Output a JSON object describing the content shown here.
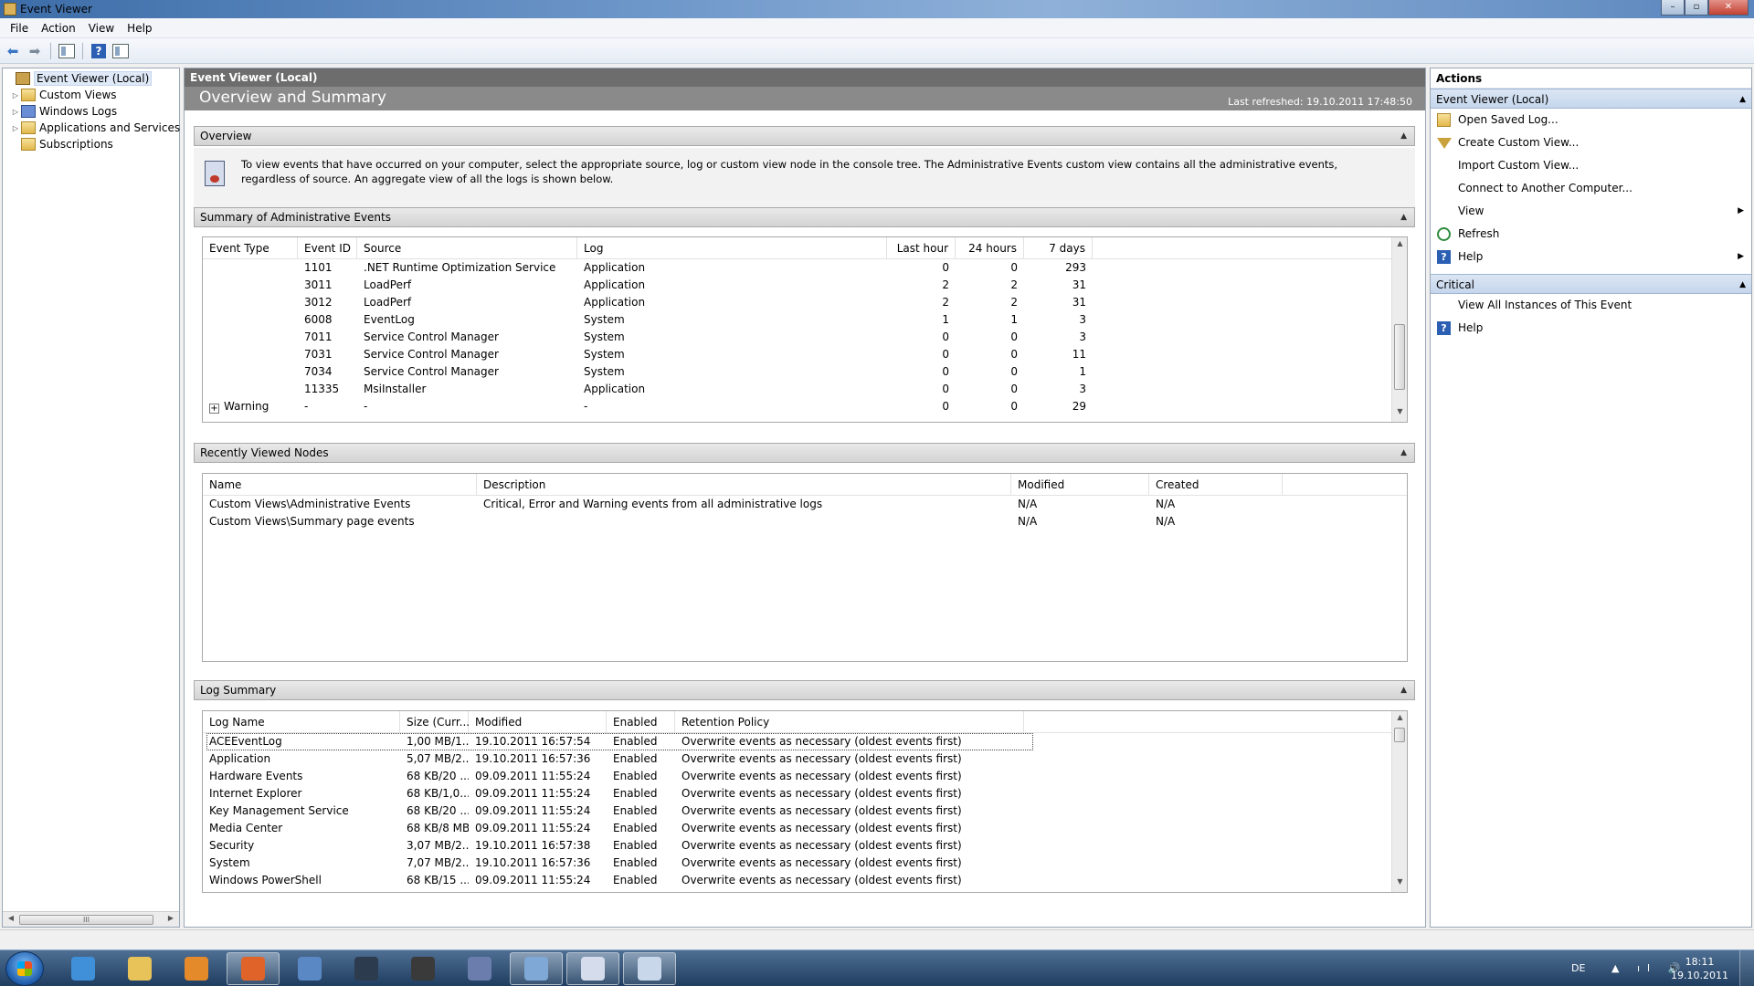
{
  "window": {
    "title": "Event Viewer",
    "buttons": [
      "–",
      "▫",
      "✕"
    ]
  },
  "menubar": [
    "File",
    "Action",
    "View",
    "Help"
  ],
  "toolbar": [
    {
      "name": "back-arrow-icon",
      "glyph": "⬅"
    },
    {
      "name": "forward-arrow-icon",
      "glyph": "➡"
    },
    {
      "name": "show-hide-console-tree-icon",
      "glyph": ""
    },
    {
      "name": "help-icon",
      "glyph": "?"
    },
    {
      "name": "show-hide-action-pane-icon",
      "glyph": ""
    }
  ],
  "tree": {
    "items": [
      {
        "label": "Event Viewer (Local)",
        "icon": "event-viewer-icon",
        "expander": "",
        "selected": true
      },
      {
        "label": "Custom Views",
        "icon": "folder-icon",
        "expander": "▷"
      },
      {
        "label": "Windows Logs",
        "icon": "windows-logs-icon",
        "expander": "▷"
      },
      {
        "label": "Applications and Services Lo",
        "icon": "folder-icon",
        "expander": "▷"
      },
      {
        "label": "Subscriptions",
        "icon": "subscriptions-icon",
        "expander": ""
      }
    ],
    "scroll_thumb": "III"
  },
  "center": {
    "header": "Event Viewer (Local)",
    "banner_title": "Overview and Summary",
    "last_refreshed": "Last refreshed: 19.10.2011 17:48:50",
    "overview": {
      "title": "Overview",
      "text": "To view events that have occurred on your computer, select the appropriate source, log or custom view node in the console tree. The Administrative Events custom view contains all the administrative events, regardless of source. An aggregate view of all the logs is shown below."
    },
    "summary": {
      "title": "Summary of Administrative Events",
      "columns": [
        "Event Type",
        "Event ID",
        "Source",
        "Log",
        "Last hour",
        "24 hours",
        "7 days"
      ],
      "rows": [
        {
          "type": "",
          "id": "1101",
          "source": ".NET Runtime Optimization Service",
          "log": "Application",
          "hour": "0",
          "day": "0",
          "week": "293"
        },
        {
          "type": "",
          "id": "3011",
          "source": "LoadPerf",
          "log": "Application",
          "hour": "2",
          "day": "2",
          "week": "31"
        },
        {
          "type": "",
          "id": "3012",
          "source": "LoadPerf",
          "log": "Application",
          "hour": "2",
          "day": "2",
          "week": "31"
        },
        {
          "type": "",
          "id": "6008",
          "source": "EventLog",
          "log": "System",
          "hour": "1",
          "day": "1",
          "week": "3"
        },
        {
          "type": "",
          "id": "7011",
          "source": "Service Control Manager",
          "log": "System",
          "hour": "0",
          "day": "0",
          "week": "3"
        },
        {
          "type": "",
          "id": "7031",
          "source": "Service Control Manager",
          "log": "System",
          "hour": "0",
          "day": "0",
          "week": "11"
        },
        {
          "type": "",
          "id": "7034",
          "source": "Service Control Manager",
          "log": "System",
          "hour": "0",
          "day": "0",
          "week": "1"
        },
        {
          "type": "",
          "id": "11335",
          "source": "MsiInstaller",
          "log": "Application",
          "hour": "0",
          "day": "0",
          "week": "3"
        },
        {
          "type": "Warning",
          "id": "-",
          "source": "-",
          "log": "-",
          "hour": "0",
          "day": "0",
          "week": "29",
          "expandable": true
        }
      ]
    },
    "recent": {
      "title": "Recently Viewed Nodes",
      "columns": [
        "Name",
        "Description",
        "Modified",
        "Created"
      ],
      "rows": [
        {
          "name": "Custom Views\\Administrative Events",
          "description": "Critical, Error and Warning events from all administrative logs",
          "modified": "N/A",
          "created": "N/A"
        },
        {
          "name": "Custom Views\\Summary page events",
          "description": "",
          "modified": "N/A",
          "created": "N/A"
        }
      ]
    },
    "logs": {
      "title": "Log Summary",
      "columns": [
        "Log Name",
        "Size (Curr...",
        "Modified",
        "Enabled",
        "Retention Policy"
      ],
      "rows": [
        {
          "name": "ACEEventLog",
          "size": "1,00 MB/1...",
          "modified": "19.10.2011 16:57:54",
          "enabled": "Enabled",
          "policy": "Overwrite events as necessary (oldest events first)"
        },
        {
          "name": "Application",
          "size": "5,07 MB/2...",
          "modified": "19.10.2011 16:57:36",
          "enabled": "Enabled",
          "policy": "Overwrite events as necessary (oldest events first)"
        },
        {
          "name": "Hardware Events",
          "size": "68 KB/20 ...",
          "modified": "09.09.2011 11:55:24",
          "enabled": "Enabled",
          "policy": "Overwrite events as necessary (oldest events first)"
        },
        {
          "name": "Internet Explorer",
          "size": "68 KB/1,0...",
          "modified": "09.09.2011 11:55:24",
          "enabled": "Enabled",
          "policy": "Overwrite events as necessary (oldest events first)"
        },
        {
          "name": "Key Management Service",
          "size": "68 KB/20 ...",
          "modified": "09.09.2011 11:55:24",
          "enabled": "Enabled",
          "policy": "Overwrite events as necessary (oldest events first)"
        },
        {
          "name": "Media Center",
          "size": "68 KB/8 MB",
          "modified": "09.09.2011 11:55:24",
          "enabled": "Enabled",
          "policy": "Overwrite events as necessary (oldest events first)"
        },
        {
          "name": "Security",
          "size": "3,07 MB/2...",
          "modified": "19.10.2011 16:57:38",
          "enabled": "Enabled",
          "policy": "Overwrite events as necessary (oldest events first)"
        },
        {
          "name": "System",
          "size": "7,07 MB/2...",
          "modified": "19.10.2011 16:57:36",
          "enabled": "Enabled",
          "policy": "Overwrite events as necessary (oldest events first)"
        },
        {
          "name": "Windows PowerShell",
          "size": "68 KB/15 ...",
          "modified": "09.09.2011 11:55:24",
          "enabled": "Enabled",
          "policy": "Overwrite events as necessary (oldest events first)"
        }
      ]
    }
  },
  "actions": {
    "title": "Actions",
    "groups": [
      {
        "label": "Event Viewer (Local)",
        "items": [
          {
            "label": "Open Saved Log...",
            "icon": "open-log-icon"
          },
          {
            "label": "Create Custom View...",
            "icon": "filter-icon"
          },
          {
            "label": "Import Custom View...",
            "icon": ""
          },
          {
            "label": "Connect to Another Computer...",
            "icon": ""
          },
          {
            "label": "View",
            "icon": "",
            "submenu": true
          },
          {
            "label": "Refresh",
            "icon": "refresh-icon"
          },
          {
            "label": "Help",
            "icon": "help-icon",
            "submenu": true
          }
        ]
      },
      {
        "label": "Critical",
        "items": [
          {
            "label": "View All Instances of This Event",
            "icon": ""
          },
          {
            "label": "Help",
            "icon": "help-icon"
          }
        ]
      }
    ]
  },
  "taskbar": {
    "apps": [
      {
        "name": "internet-explorer-icon",
        "color": "#3f8fd9",
        "active": false
      },
      {
        "name": "explorer-folder-icon",
        "color": "#e8c35a",
        "active": false
      },
      {
        "name": "media-player-icon",
        "color": "#e58a2a",
        "active": false
      },
      {
        "name": "firefox-icon",
        "color": "#e0642a",
        "active": true
      },
      {
        "name": "thunderbird-icon",
        "color": "#5a88c4",
        "active": false
      },
      {
        "name": "steam-icon",
        "color": "#2d3b4e",
        "active": false
      },
      {
        "name": "ch-app-icon",
        "color": "#3a3a3a",
        "active": false
      },
      {
        "name": "mirc-icon",
        "color": "#6a7dad",
        "active": false
      },
      {
        "name": "control-panel-icon",
        "color": "#7fa8d6",
        "active": true
      },
      {
        "name": "event-viewer-task-icon",
        "color": "#d5dceb",
        "active": true
      },
      {
        "name": "paint-icon",
        "color": "#c9d7ea",
        "active": true
      }
    ],
    "tray": {
      "language": "DE",
      "icons": "▲ ıl 🔊",
      "time": "18:11",
      "date": "19.10.2011"
    }
  }
}
